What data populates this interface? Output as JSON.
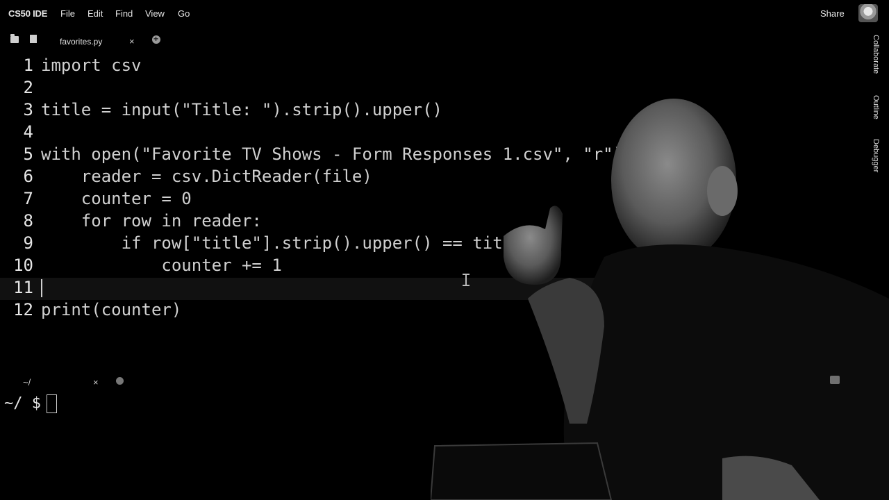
{
  "menubar": {
    "brand": "CS50 IDE",
    "items": [
      "File",
      "Edit",
      "Find",
      "View",
      "Go"
    ],
    "share_label": "Share"
  },
  "tabs": {
    "active_file": "favorites.py",
    "close_glyph": "×"
  },
  "side_panel": [
    "Collaborate",
    "Outline",
    "Debugger"
  ],
  "editor": {
    "lines": [
      {
        "n": "1",
        "code": "import csv"
      },
      {
        "n": "2",
        "code": ""
      },
      {
        "n": "3",
        "code": "title = input(\"Title: \").strip().upper()"
      },
      {
        "n": "4",
        "code": ""
      },
      {
        "n": "5",
        "code": "with open(\"Favorite TV Shows - Form Responses 1.csv\", \"r\")"
      },
      {
        "n": "6",
        "code": "    reader = csv.DictReader(file)"
      },
      {
        "n": "7",
        "code": "    counter = 0"
      },
      {
        "n": "8",
        "code": "    for row in reader:"
      },
      {
        "n": "9",
        "code": "        if row[\"title\"].strip().upper() == titl"
      },
      {
        "n": "10",
        "code": "            counter += 1"
      },
      {
        "n": "11",
        "code": ""
      },
      {
        "n": "12",
        "code": "print(counter)"
      }
    ],
    "cursor_line": "11"
  },
  "terminal": {
    "tab_label": "~/",
    "close_glyph": "×",
    "prompt": "~/ $"
  },
  "icons": {
    "folder": "folder-icon",
    "file": "file-icon",
    "add_tab": "plus-circle-icon",
    "avatar": "user-avatar-icon",
    "terminal_settings": "settings-icon"
  }
}
